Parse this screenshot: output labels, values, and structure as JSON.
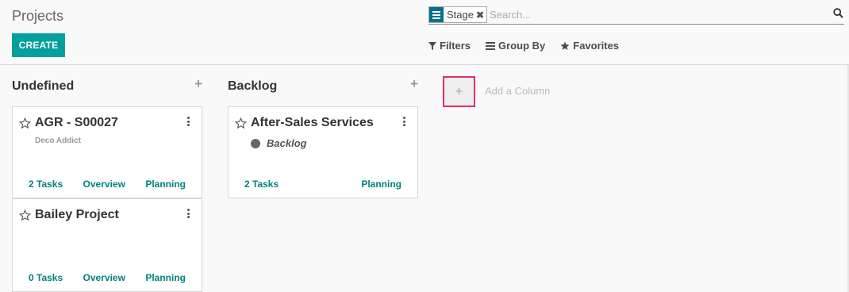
{
  "header": {
    "title": "Projects",
    "create_label": "CREATE"
  },
  "search": {
    "facet_value": "Stage",
    "facet_remove": "✖",
    "placeholder": "Search..."
  },
  "filters": {
    "filters_label": "Filters",
    "group_by_label": "Group By",
    "favorites_label": "Favorites"
  },
  "columns": [
    {
      "title": "Undefined",
      "add": "+",
      "cards": [
        {
          "title": "AGR - S00027",
          "subtitle": "Deco Addict",
          "tasks": "2 Tasks",
          "overview": "Overview",
          "planning": "Planning"
        },
        {
          "title": "Bailey Project",
          "tasks": "0 Tasks",
          "overview": "Overview",
          "planning": "Planning"
        }
      ]
    },
    {
      "title": "Backlog",
      "add": "+",
      "cards": [
        {
          "title": "After-Sales Services",
          "stage": "Backlog",
          "tasks": "2 Tasks",
          "planning": "Planning"
        }
      ]
    }
  ],
  "add_column": {
    "plus": "+",
    "label": "Add a Column"
  },
  "colors": {
    "accent": "#00a09d",
    "link": "#00817e",
    "highlight": "#e0306a"
  }
}
